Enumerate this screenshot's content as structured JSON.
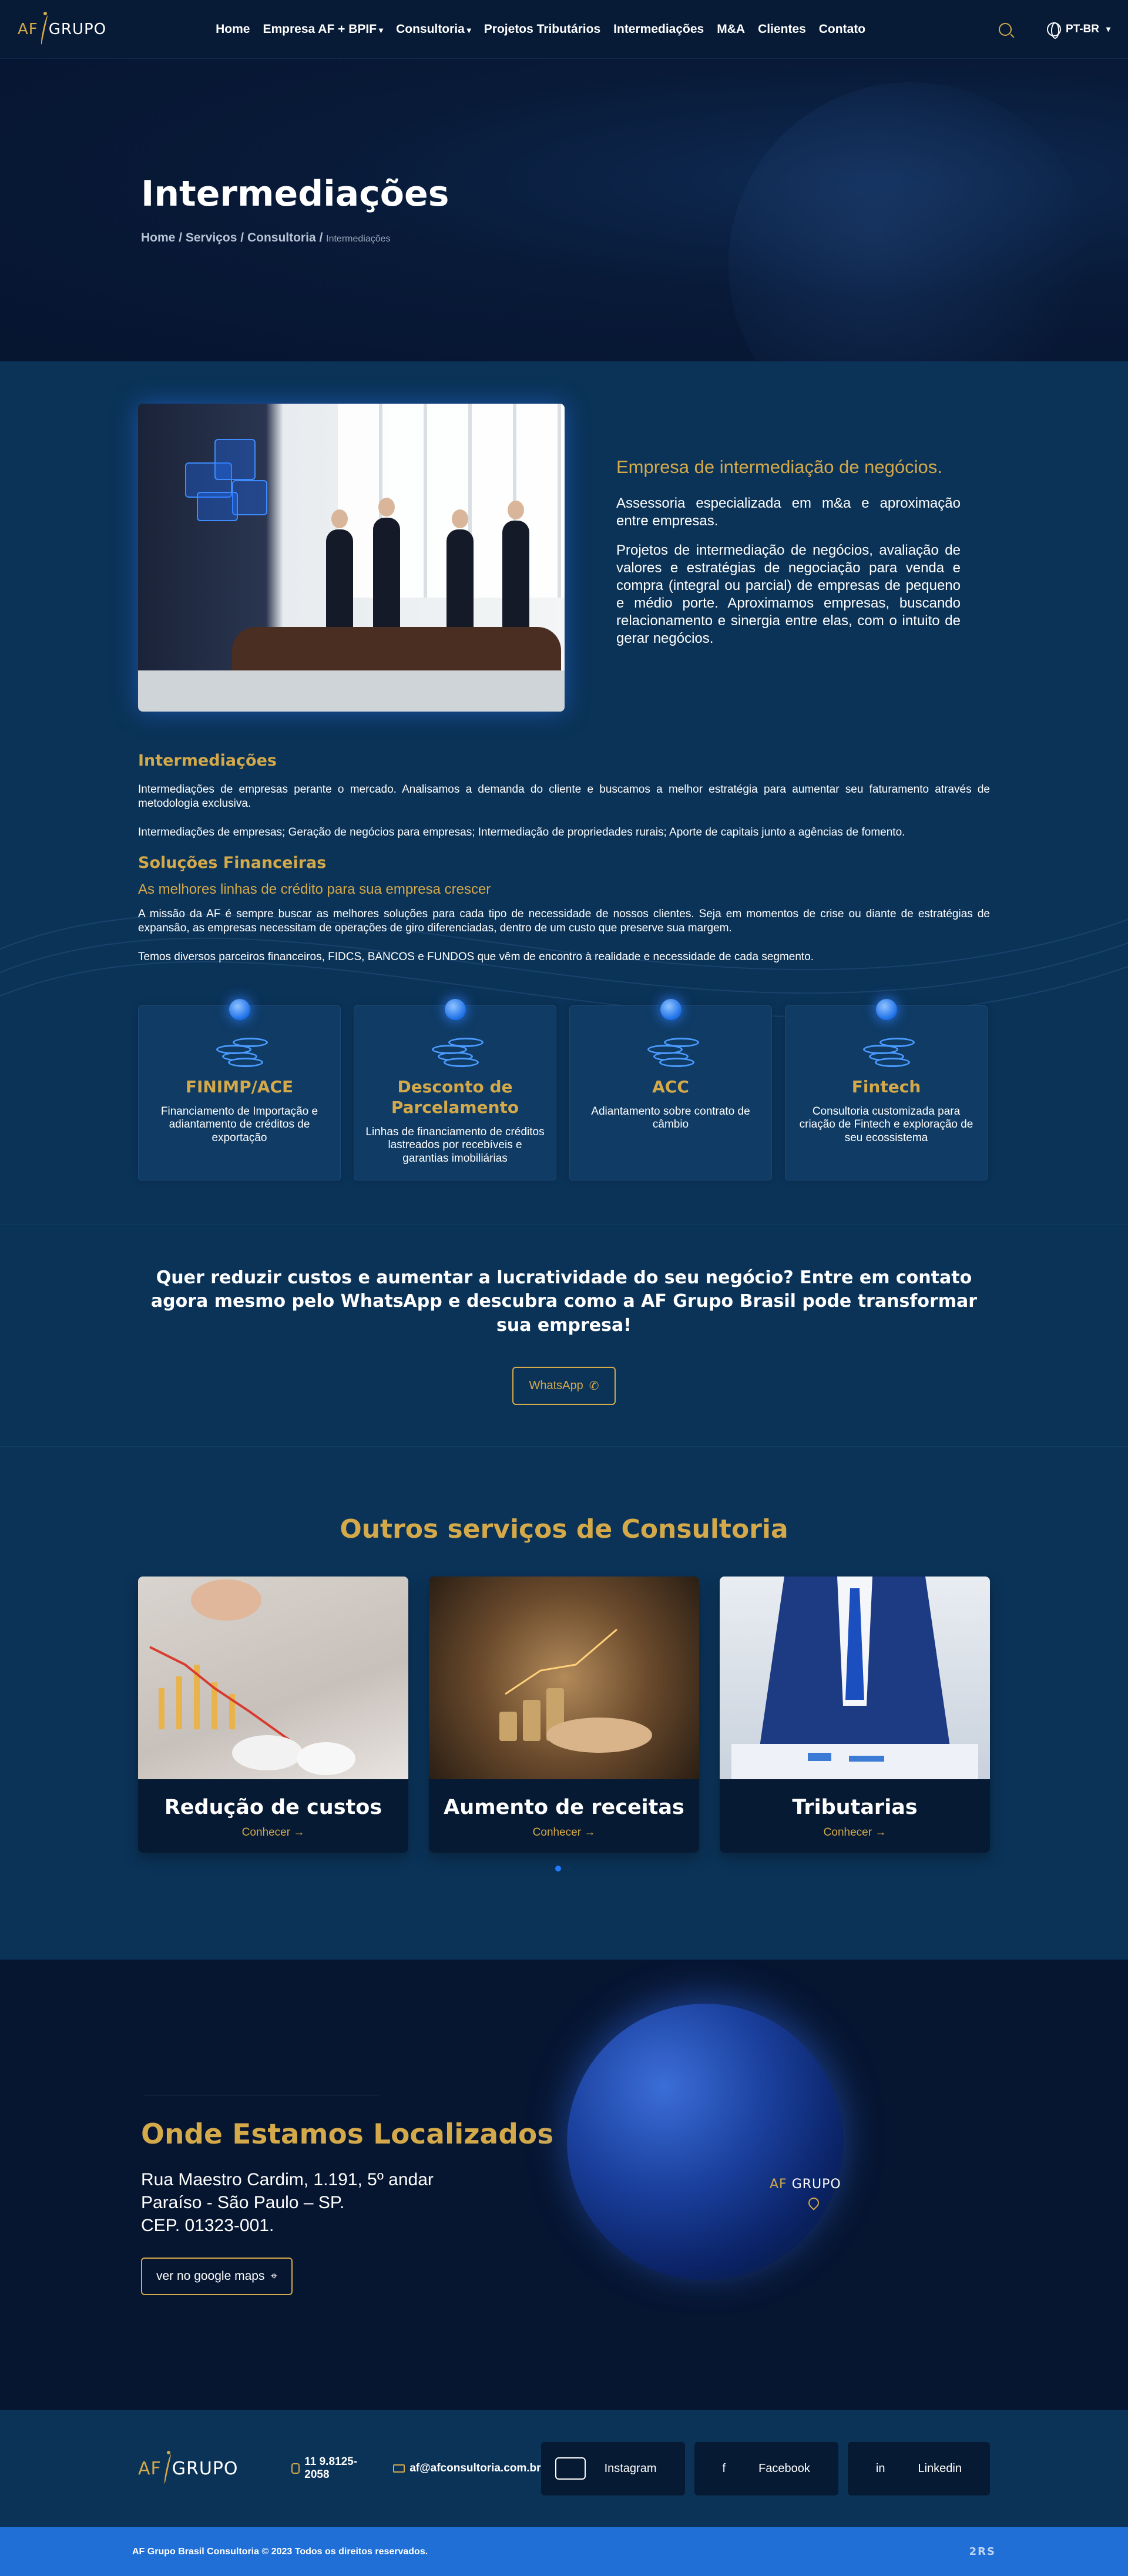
{
  "nav": {
    "logo_a": "AF",
    "logo_g": "GRUPO",
    "items": [
      "Home",
      "Empresa AF + BPIF",
      "Consultoria",
      "Projetos Tributários",
      "Intermediações",
      "M&A",
      "Clientes",
      "Contato"
    ],
    "language": "PT-BR"
  },
  "hero": {
    "title": "Intermediações",
    "breadcrumb": [
      "Home",
      "Serviços",
      "Consultoria"
    ],
    "breadcrumb_current": "Intermediações"
  },
  "intro": {
    "heading": "Empresa de intermediação de negócios.",
    "p1": "Assessoria especializada em m&a e aproximação entre empresas.",
    "p2": "Projetos de intermediação de negócios, avaliação de valores e estratégias de negociação para venda e compra (integral ou parcial) de empresas de pequeno e médio porte. Aproximamos empresas, buscando relacionamento e sinergia entre elas, com o intuito de gerar negócios."
  },
  "body": {
    "inter_title": "Intermediações",
    "inter_p1": "Intermediações de empresas perante o mercado. Analisamos a demanda do cliente e buscamos a melhor estratégia para aumentar seu faturamento através de metodologia exclusiva.",
    "inter_p2": "Intermediações de empresas; Geração de negócios para empresas; Intermediação de propriedades rurais; Aporte de capitais junto a agências de fomento.",
    "sol_title": "Soluções Financeiras",
    "sol_subtitle": "As melhores linhas de crédito para sua empresa crescer",
    "sol_p1": "A missão da AF é sempre buscar as melhores soluções para cada tipo de necessidade de nossos clientes. Seja em momentos de crise ou diante de estratégias de expansão, as empresas necessitam de operações de giro diferenciadas, dentro de um custo que preserve sua margem.",
    "sol_p2": "Temos diversos parceiros financeiros, FIDCS, BANCOS e FUNDOS que vêm de encontro à realidade e necessidade de cada segmento."
  },
  "cards": [
    {
      "title": "FINIMP/ACE",
      "text": "Financiamento de Importação e adiantamento de créditos de exportação"
    },
    {
      "title": "Desconto de Parcelamento",
      "text": "Linhas de financiamento de créditos lastreados por recebíveis e garantias imobiliárias"
    },
    {
      "title": "ACC",
      "text": "Adiantamento sobre contrato de câmbio"
    },
    {
      "title": "Fintech",
      "text": "Consultoria customizada para criação de Fintech e exploração de seu ecossistema"
    }
  ],
  "cta": {
    "text": "Quer reduzir custos e aumentar a lucratividade do seu negócio? Entre em contato agora mesmo pelo WhatsApp e descubra como a AF Grupo Brasil pode transformar sua empresa!",
    "button": "WhatsApp"
  },
  "others": {
    "title": "Outros serviços de Consultoria",
    "items": [
      {
        "title": "Redução de custos",
        "link": "Conhecer"
      },
      {
        "title": "Aumento de receitas",
        "link": "Conhecer"
      },
      {
        "title": "Tributarias",
        "link": "Conhecer"
      }
    ]
  },
  "location": {
    "title": "Onde Estamos Localizados",
    "line1": "Rua Maestro Cardim, 1.191, 5º andar",
    "line2": "Paraíso - São Paulo – SP.",
    "line3": "CEP. 01323-001.",
    "button": "ver no google maps"
  },
  "footer": {
    "phone": "11 9.8125-2058",
    "email": "af@afconsultoria.com.br",
    "social": [
      "Instagram",
      "Facebook",
      "Linkedin"
    ],
    "copyright": "AF Grupo Brasil Consultoria © 2023 Todos os direitos reservados.",
    "badge": "2RS"
  },
  "colors": {
    "gold": "#d4a94a",
    "navy": "#061530",
    "blue": "#0b3358",
    "accent": "#1f6fd6"
  }
}
